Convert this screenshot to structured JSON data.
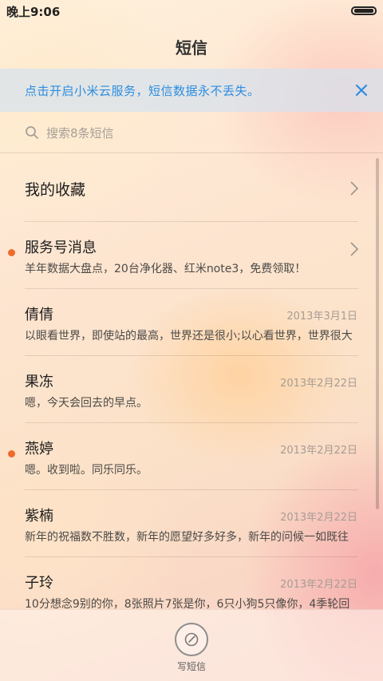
{
  "status_bar": {
    "time": "晚上9:06",
    "battery_level": 1.0
  },
  "header": {
    "title": "短信"
  },
  "banner": {
    "text": "点击开启小米云服务，短信数据永不丢失。",
    "accent": "#2c8de0"
  },
  "search": {
    "placeholder": "搜索8条短信"
  },
  "favorites": {
    "label": "我的收藏"
  },
  "service": {
    "name": "服务号消息",
    "snippet": "羊年数据大盘点，20台净化器、红米note3，免费领取！",
    "unread": true
  },
  "conversations": [
    {
      "name": "倩倩",
      "date": "2013年3月1日",
      "snippet": "以眼看世界，即使站的最高，世界还是很小;以心看世界，世界很大",
      "unread": false
    },
    {
      "name": "果冻",
      "date": "2013年2月22日",
      "snippet": "嗯，今天会回去的早点。",
      "unread": false
    },
    {
      "name": "燕婷",
      "date": "2013年2月22日",
      "snippet": "嗯。收到啦。同乐同乐。",
      "unread": true
    },
    {
      "name": "紫楠",
      "date": "2013年2月22日",
      "snippet": "新年的祝福数不胜数，新年的愿望好多好多，新年的问候一如既往",
      "unread": false
    },
    {
      "name": "子玲",
      "date": "2013年2月22日",
      "snippet": "10分想念9别的你，8张照片7张是你，6只小狗5只像你，4季轮回",
      "unread": false
    }
  ],
  "compose": {
    "label": "写短信"
  },
  "colors": {
    "unread_dot": "#f06a2a",
    "accent": "#2c8de0"
  }
}
